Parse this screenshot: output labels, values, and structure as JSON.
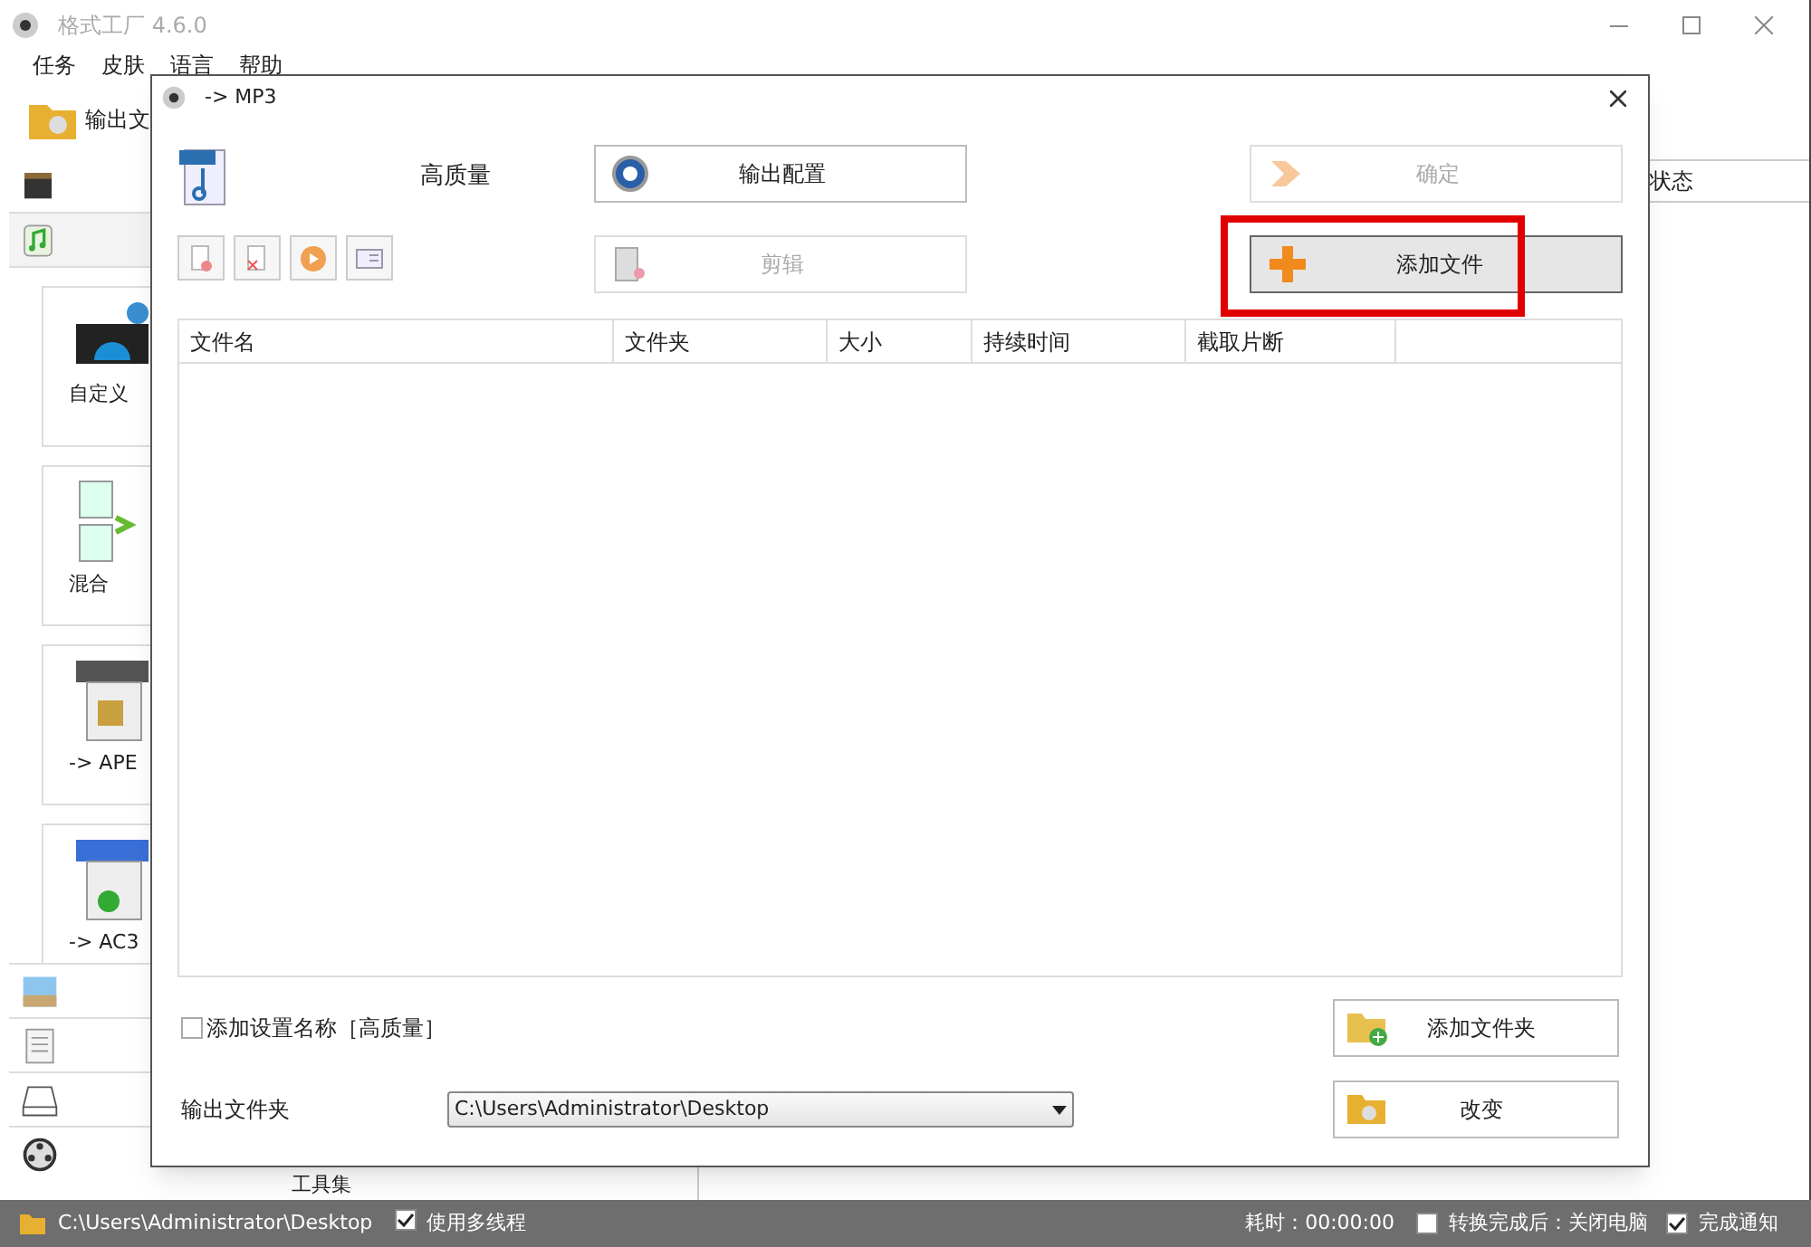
{
  "window": {
    "title": "格式工厂 4.6.0"
  },
  "menu": [
    "任务",
    "皮肤",
    "语言",
    "帮助"
  ],
  "toolbar": {
    "output_folder": "输出文"
  },
  "categories_top": [
    {
      "kind": "video",
      "selected": false
    },
    {
      "kind": "audio",
      "selected": true
    }
  ],
  "cards": [
    {
      "kind": "custom",
      "label": "自定义"
    },
    {
      "kind": "mix",
      "label": "混合"
    },
    {
      "kind": "ape",
      "label": "-> APE"
    },
    {
      "kind": "aac",
      "label": "-> AC3"
    }
  ],
  "categories_bottom": [
    {
      "kind": "image"
    },
    {
      "kind": "document"
    },
    {
      "kind": "disc"
    },
    {
      "kind": "tools",
      "label": "工具集"
    }
  ],
  "task_list": {
    "columns": [
      "状态"
    ]
  },
  "dialog": {
    "title": "-> MP3",
    "quality": "高质量",
    "buttons": [
      {
        "kind": "config",
        "label": "输出配置",
        "disabled": false
      },
      {
        "kind": "ok",
        "label": "确定",
        "disabled": true
      },
      {
        "kind": "clip",
        "label": "剪辑",
        "disabled": true
      },
      {
        "kind": "add",
        "label": "添加文件",
        "disabled": false,
        "highlighted": true
      }
    ],
    "tools": [
      {
        "kind": "remove"
      },
      {
        "kind": "clear"
      },
      {
        "kind": "play"
      },
      {
        "kind": "info"
      }
    ],
    "table": {
      "columns": [
        "文件名",
        "文件夹",
        "大小",
        "持续时间",
        "截取片断"
      ]
    },
    "add_setting_name": {
      "label": "添加设置名称［高质量］",
      "checked": false
    },
    "add_folder": "添加文件夹",
    "output_folder": {
      "label": "输出文件夹",
      "value": "C:\\Users\\Administrator\\Desktop"
    },
    "change": "改变"
  },
  "status_bar": {
    "path": "C:\\Users\\Administrator\\Desktop",
    "multithread": {
      "label": "使用多线程",
      "checked": true
    },
    "elapsed": "耗时：00:00:00",
    "shutdown": {
      "label": "转换完成后：关闭电脑",
      "checked": false
    },
    "notify": {
      "label": "完成通知",
      "checked": true
    }
  }
}
